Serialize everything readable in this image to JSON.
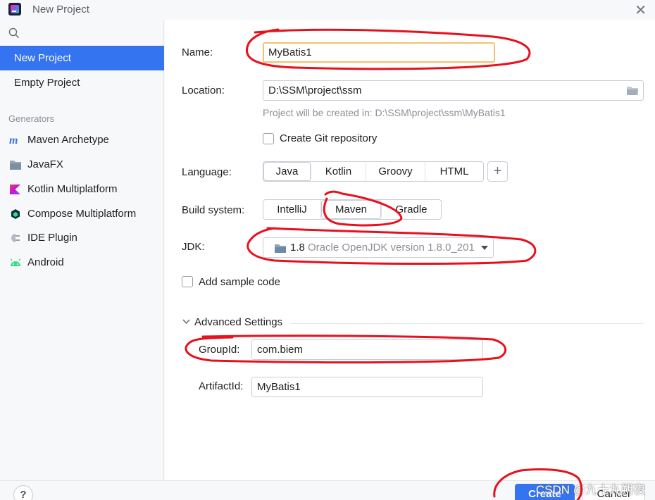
{
  "window": {
    "title": "New Project"
  },
  "sidebar": {
    "top_items": [
      {
        "label": "New Project",
        "selected": true
      },
      {
        "label": "Empty Project",
        "selected": false
      }
    ],
    "generators_label": "Generators",
    "generators": [
      {
        "label": "Maven Archetype",
        "icon": "maven-icon"
      },
      {
        "label": "JavaFX",
        "icon": "javafx-icon"
      },
      {
        "label": "Kotlin Multiplatform",
        "icon": "kotlin-icon"
      },
      {
        "label": "Compose Multiplatform",
        "icon": "compose-icon"
      },
      {
        "label": "IDE Plugin",
        "icon": "plugin-icon"
      },
      {
        "label": "Android",
        "icon": "android-icon"
      }
    ]
  },
  "form": {
    "name_label": "Name:",
    "name_value": "MyBatis1",
    "location_label": "Location:",
    "location_value": "D:\\SSM\\project\\ssm",
    "location_hint": "Project will be created in: D:\\SSM\\project\\ssm\\MyBatis1",
    "git_label": "Create Git repository",
    "git_checked": false,
    "language_label": "Language:",
    "languages": [
      "Java",
      "Kotlin",
      "Groovy",
      "HTML"
    ],
    "language_selected": "Java",
    "build_label": "Build system:",
    "build_systems": [
      "IntelliJ",
      "Maven",
      "Gradle"
    ],
    "build_selected": "Maven",
    "jdk_label": "JDK:",
    "jdk_version": "1.8",
    "jdk_name": "Oracle OpenJDK version 1.8.0_201",
    "sample_label": "Add sample code",
    "sample_checked": false,
    "advanced_label": "Advanced Settings",
    "groupid_label": "GroupId:",
    "groupid_value": "com.biem",
    "artifactid_label": "ArtifactId:",
    "artifactid_value": "MyBatis1"
  },
  "footer": {
    "help_label": "?",
    "create_label": "Create",
    "cancel_label": "Cancel",
    "watermark": "CSDN @九十九朔夜"
  },
  "colors": {
    "accent": "#3574f0",
    "focus_border": "#f5c06e",
    "annotation": "#e8101c"
  }
}
